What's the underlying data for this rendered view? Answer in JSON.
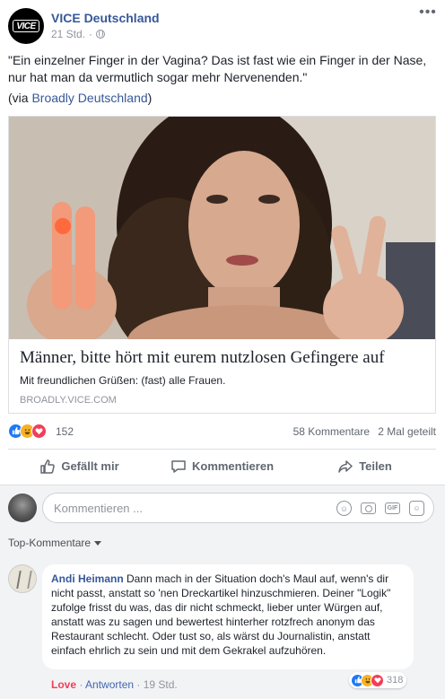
{
  "post": {
    "page_name": "VICE Deutschland",
    "logo_text": "VICE",
    "time": "21 Std.",
    "separator": "·",
    "more_label": "•••",
    "text": "\"Ein einzelner Finger in der Vagina? Das ist fast wie ein Finger in der Nase, nur hat man da vermutlich sogar mehr Nervenenden.\"",
    "via_prefix": "(via ",
    "via_link": "Broadly Deutschland",
    "via_suffix": ")"
  },
  "link_preview": {
    "title": "Männer, bitte hört mit eurem nutzlosen Gefingere auf",
    "description": "Mit freundlichen Grüßen: (fast) alle Frauen.",
    "domain": "BROADLY.VICE.COM"
  },
  "stats": {
    "reactions_count": "152",
    "comments": "58 Kommentare",
    "shares": "2 Mal geteilt"
  },
  "actions": {
    "like": "Gefällt mir",
    "comment": "Kommentieren",
    "share": "Teilen"
  },
  "composer": {
    "placeholder": "Kommentieren ..."
  },
  "icons": {
    "emoji": "☺",
    "gif": "GIF",
    "sticker": "☺"
  },
  "filter": {
    "label": "Top-Kommentare"
  },
  "comment": {
    "author": "Andi Heimann",
    "text": "Dann mach in der Situation doch's Maul auf, wenn's dir nicht passt, anstatt so 'nen Dreckartikel hinzuschmieren. Deiner \"Logik\" zufolge frisst du was, das dir nicht schmeckt, lieber unter Würgen auf, anstatt was zu sagen und bewertest hinterher rotzfrech anonym das Restaurant schlecht. Oder tust so, als wärst du Journalistin, anstatt einfach ehrlich zu sein und mit dem Gekrakel aufzuhören.",
    "reactions_count": "318",
    "love_label": "Love",
    "reply_label": "Antworten",
    "time": "19 Std.",
    "dot": " · "
  },
  "colors": {
    "link_blue": "#365899",
    "like_blue": "#2078f4",
    "love_red": "#f33e58",
    "haha_yellow": "#f7b125"
  }
}
